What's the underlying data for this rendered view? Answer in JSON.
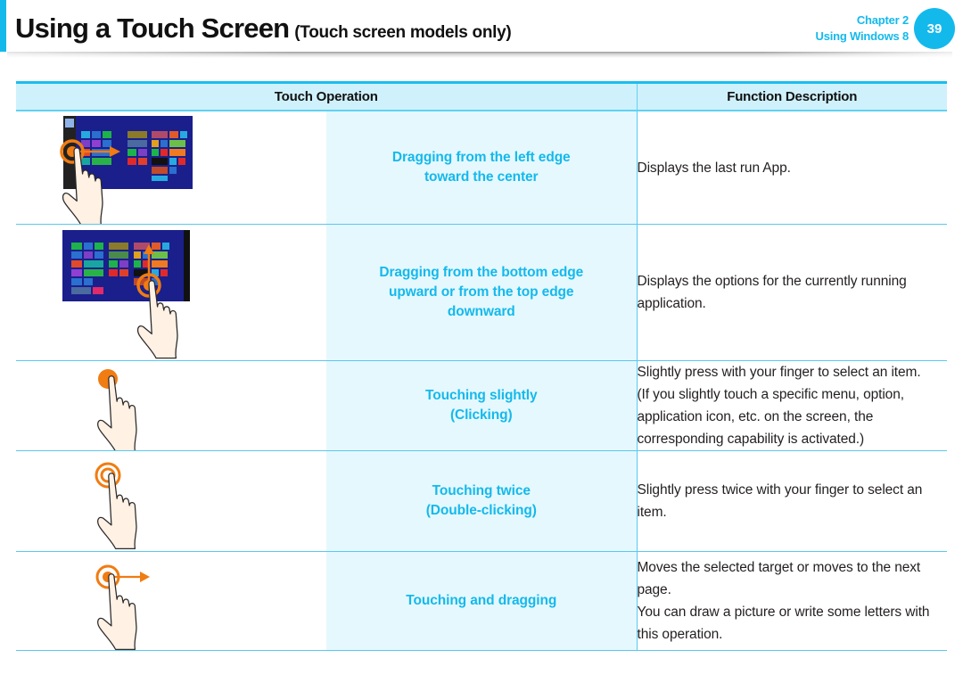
{
  "header": {
    "title": "Using a Touch Screen",
    "subtitle": "(Touch screen models only)",
    "chapter_label": "Chapter 2",
    "chapter_name": "Using Windows 8",
    "page_number": "39",
    "accent_color": "#14b9ec"
  },
  "table": {
    "columns": [
      "Touch Operation",
      "Function Description"
    ],
    "rows": [
      {
        "illustration": "drag-from-left-edge-icon",
        "name_lines": [
          "Dragging from the left edge",
          "toward the center"
        ],
        "description": [
          "Displays the last run App."
        ]
      },
      {
        "illustration": "drag-from-bottom-edge-icon",
        "name_lines": [
          "Dragging from the bottom edge",
          "upward or from the top edge",
          "downward"
        ],
        "description": [
          "Displays the options for the currently running application."
        ]
      },
      {
        "illustration": "tap-icon",
        "name_lines": [
          "Touching slightly",
          "(Clicking)"
        ],
        "description": [
          "Slightly press with your finger to select an item.",
          "(If you slightly touch a specific menu, option, application icon, etc. on the screen, the corresponding capability is activated.)"
        ]
      },
      {
        "illustration": "double-tap-icon",
        "name_lines": [
          "Touching twice",
          "(Double-clicking)"
        ],
        "description": [
          "Slightly press twice with your finger to select an item."
        ]
      },
      {
        "illustration": "touch-and-drag-icon",
        "name_lines": [
          "Touching and dragging"
        ],
        "description": [
          "Moves the selected target or moves to the next page.",
          "You can draw a picture or write some letters with this operation."
        ]
      }
    ]
  }
}
